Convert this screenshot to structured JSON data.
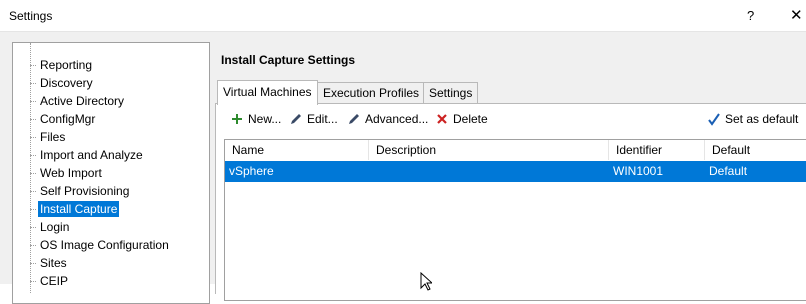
{
  "window": {
    "title": "Settings",
    "help_label": "?",
    "close_label": "✕"
  },
  "tree": {
    "items": [
      {
        "label": "Reporting"
      },
      {
        "label": "Discovery"
      },
      {
        "label": "Active Directory"
      },
      {
        "label": "ConfigMgr"
      },
      {
        "label": "Files"
      },
      {
        "label": "Import and Analyze"
      },
      {
        "label": "Web Import"
      },
      {
        "label": "Self Provisioning"
      },
      {
        "label": "Install Capture",
        "selected": true
      },
      {
        "label": "Login"
      },
      {
        "label": "OS Image Configuration"
      },
      {
        "label": "Sites"
      },
      {
        "label": "CEIP"
      }
    ]
  },
  "main": {
    "title": "Install Capture Settings",
    "tabs": [
      {
        "label": "Virtual Machines",
        "active": true
      },
      {
        "label": "Execution Profiles"
      },
      {
        "label": "Settings"
      }
    ],
    "toolbar": {
      "new_label": "New...",
      "edit_label": "Edit...",
      "advanced_label": "Advanced...",
      "delete_label": "Delete",
      "set_default_label": "Set as default"
    },
    "grid": {
      "columns": [
        "Name",
        "Description",
        "Identifier",
        "Default"
      ],
      "rows": [
        {
          "name": "vSphere",
          "description": "",
          "identifier": "WIN1001",
          "default": "Default",
          "selected": true
        }
      ]
    }
  },
  "colors": {
    "selection": "#0078d7",
    "new_icon": "#2e8b2e",
    "delete_icon": "#cc2222",
    "check_icon": "#1a5fb4"
  }
}
